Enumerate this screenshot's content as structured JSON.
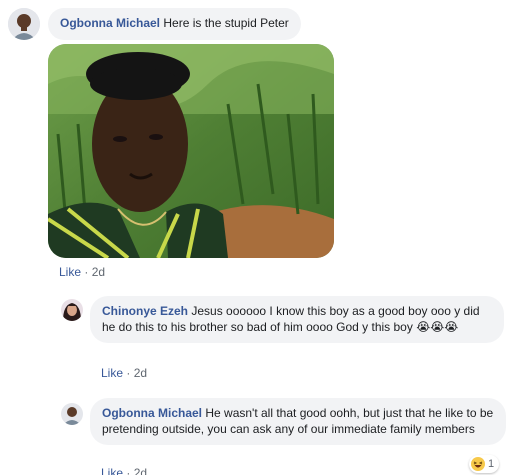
{
  "comments": [
    {
      "author": "Ogbonna Michael",
      "text": "Here is the stupid Peter",
      "like_label": "Like",
      "separator": " · ",
      "time": "2d"
    },
    {
      "author": "Chinonye Ezeh",
      "text": "Jesus oooooo I know this boy as a good boy ooo y did he do this to his brother so bad of him oooo God y this boy",
      "emoji": "😭😭😭",
      "like_label": "Like",
      "separator": " · ",
      "time": "2d"
    },
    {
      "author": "Ogbonna Michael",
      "text": "He wasn't all that good oohh, but just that he like to be pretending outside, you can ask any of our immediate family members",
      "like_label": "Like",
      "separator": " · ",
      "time": "2d",
      "reaction_count": "1"
    }
  ],
  "colors": {
    "author_link": "#385898",
    "bubble_bg": "#f2f3f5",
    "meta_text": "#606770"
  },
  "icons": {
    "reaction": "laughing-face-icon",
    "comment_emoji": "crying-face-emoji"
  }
}
